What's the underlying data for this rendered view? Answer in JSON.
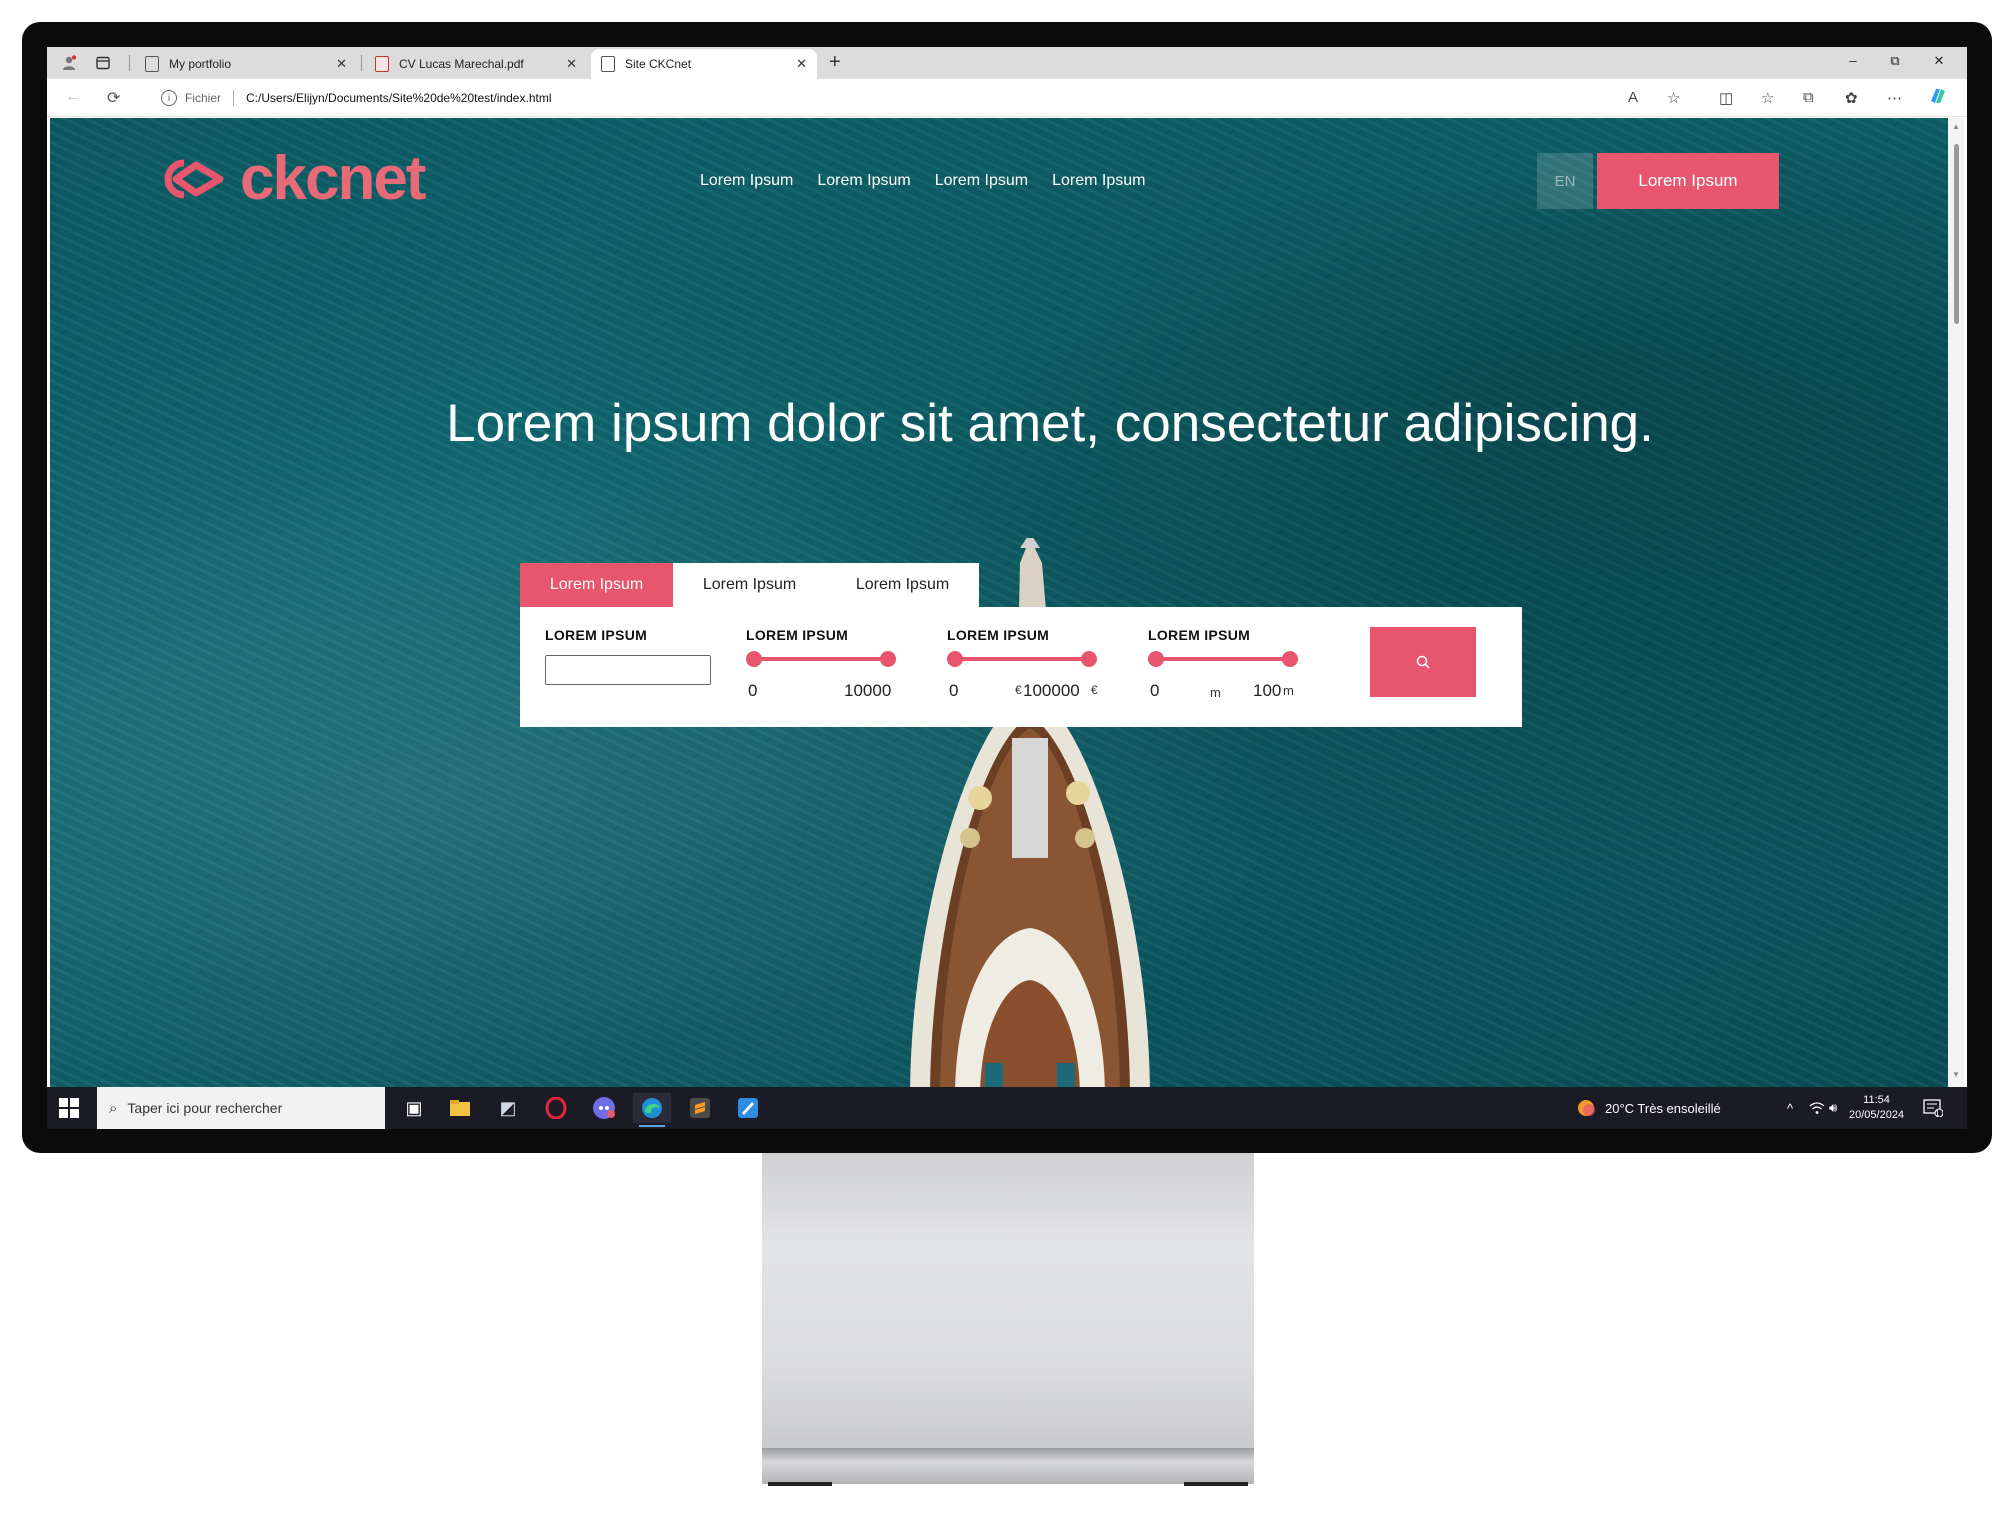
{
  "browser": {
    "tabs": [
      {
        "title": "My portfolio",
        "active": false
      },
      {
        "title": "CV Lucas Marechal.pdf",
        "active": false
      },
      {
        "title": "Site CKCnet",
        "active": true
      }
    ],
    "new_tab_symbol": "+",
    "window_controls": {
      "minimize": "–",
      "restore": "⧉",
      "close": "✕"
    },
    "address": {
      "protocol_label": "Fichier",
      "url": "C:/Users/Elijyn/Documents/Site%20de%20test/index.html"
    }
  },
  "site": {
    "logo_text": "ckcnet",
    "nav": [
      "Lorem Ipsum",
      "Lorem Ipsum",
      "Lorem Ipsum",
      "Lorem Ipsum"
    ],
    "lang": "EN",
    "cta": "Lorem Ipsum",
    "hero_title": "Lorem ipsum dolor sit amet, consectetur adipiscing.",
    "search_tabs": [
      "Lorem Ipsum",
      "Lorem Ipsum",
      "Lorem Ipsum"
    ],
    "fields": [
      {
        "label": "LOREM IPSUM"
      },
      {
        "label": "LOREM IPSUM",
        "min": "0",
        "max": "10000"
      },
      {
        "label": "LOREM IPSUM",
        "min": "0",
        "max": "100000",
        "unit": "€"
      },
      {
        "label": "LOREM IPSUM",
        "min": "0",
        "max": "100",
        "unit": "m"
      }
    ],
    "colors": {
      "accent": "#e8566e",
      "ocean": "#0f6a73"
    }
  },
  "taskbar": {
    "search_placeholder": "Taper ici pour rechercher",
    "weather": "20°C  Très ensoleillé",
    "time": "11:54",
    "date": "20/05/2024",
    "notification_count": "1"
  }
}
